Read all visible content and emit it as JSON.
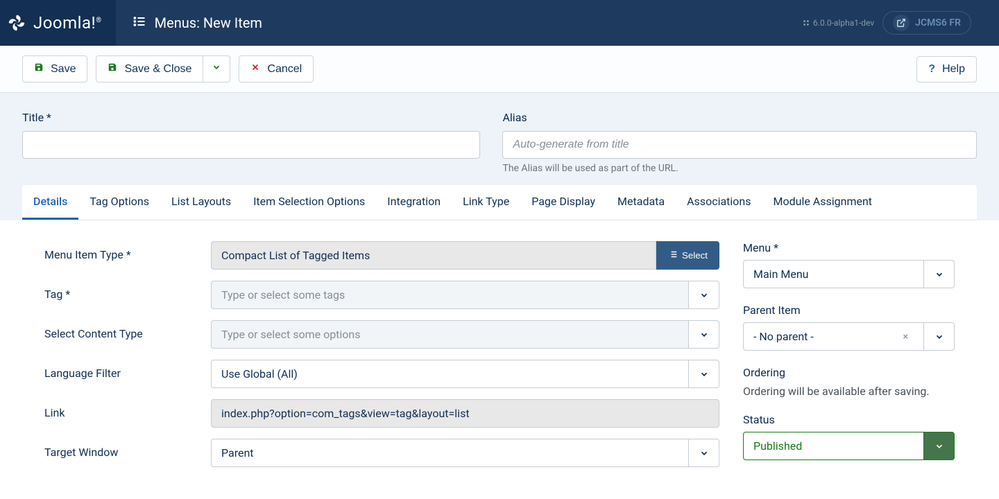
{
  "header": {
    "logo_text": "Joomla!",
    "page_title": "Menus: New Item",
    "version": "6.0.0-alpha1-dev",
    "site_name": "JCMS6 FR"
  },
  "toolbar": {
    "save": "Save",
    "save_close": "Save & Close",
    "cancel": "Cancel",
    "help": "Help"
  },
  "form_header": {
    "title_label": "Title *",
    "alias_label": "Alias",
    "alias_placeholder": "Auto-generate from title",
    "alias_help": "The Alias will be used as part of the URL."
  },
  "tabs": [
    "Details",
    "Tag Options",
    "List Layouts",
    "Item Selection Options",
    "Integration",
    "Link Type",
    "Page Display",
    "Metadata",
    "Associations",
    "Module Assignment"
  ],
  "fields": {
    "menu_item_type": {
      "label": "Menu Item Type *",
      "value": "Compact List of Tagged Items",
      "select_btn": "Select"
    },
    "tag": {
      "label": "Tag *",
      "placeholder": "Type or select some tags"
    },
    "content_type": {
      "label": "Select Content Type",
      "placeholder": "Type or select some options"
    },
    "language_filter": {
      "label": "Language Filter",
      "value": "Use Global (All)"
    },
    "link": {
      "label": "Link",
      "value": "index.php?option=com_tags&view=tag&layout=list"
    },
    "target_window": {
      "label": "Target Window",
      "value": "Parent"
    }
  },
  "sidebar": {
    "menu": {
      "label": "Menu *",
      "value": "Main Menu"
    },
    "parent": {
      "label": "Parent Item",
      "value": "- No parent -"
    },
    "ordering": {
      "label": "Ordering",
      "text": "Ordering will be available after saving."
    },
    "status": {
      "label": "Status",
      "value": "Published"
    }
  }
}
